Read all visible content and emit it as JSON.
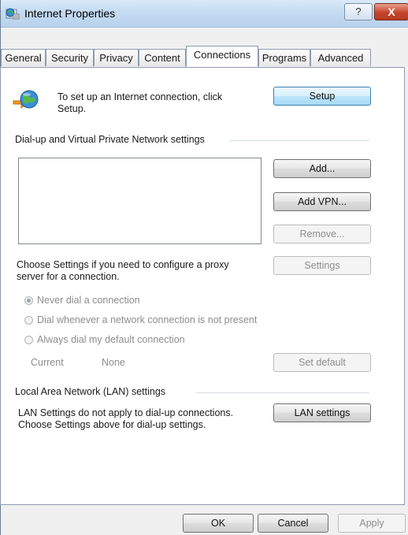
{
  "window": {
    "title": "Internet Properties",
    "help_label": "?",
    "close_label": "X",
    "icon": "internet-properties-icon"
  },
  "tabs": [
    {
      "label": "General",
      "active": false
    },
    {
      "label": "Security",
      "active": false
    },
    {
      "label": "Privacy",
      "active": false
    },
    {
      "label": "Content",
      "active": false
    },
    {
      "label": "Connections",
      "active": true
    },
    {
      "label": "Programs",
      "active": false
    },
    {
      "label": "Advanced",
      "active": false
    }
  ],
  "setup": {
    "icon": "globe-network-icon",
    "text_line1": "To set up an Internet connection, click",
    "text_line2": "Setup.",
    "button": "Setup"
  },
  "dialup": {
    "heading": "Dial-up and Virtual Private Network settings",
    "add": "Add...",
    "add_vpn": "Add VPN...",
    "remove": "Remove...",
    "proxy_text_line1": "Choose Settings if you need to configure a proxy",
    "proxy_text_line2": "server for a connection.",
    "settings": "Settings",
    "radio_never": "Never dial a connection",
    "radio_whenever": "Dial whenever a network connection is not present",
    "radio_always": "Always dial my default connection",
    "current_label": "Current",
    "current_value": "None",
    "set_default": "Set default"
  },
  "lan": {
    "heading": "Local Area Network (LAN) settings",
    "text_line1": "LAN Settings do not apply to dial-up connections.",
    "text_line2": "Choose Settings above for dial-up settings.",
    "button": "LAN settings"
  },
  "footer": {
    "ok": "OK",
    "cancel": "Cancel",
    "apply": "Apply"
  },
  "colors": {
    "titlebar": "#c6dcf3",
    "close_button": "#c6442b",
    "dialog_bg": "#f0f0f0"
  }
}
